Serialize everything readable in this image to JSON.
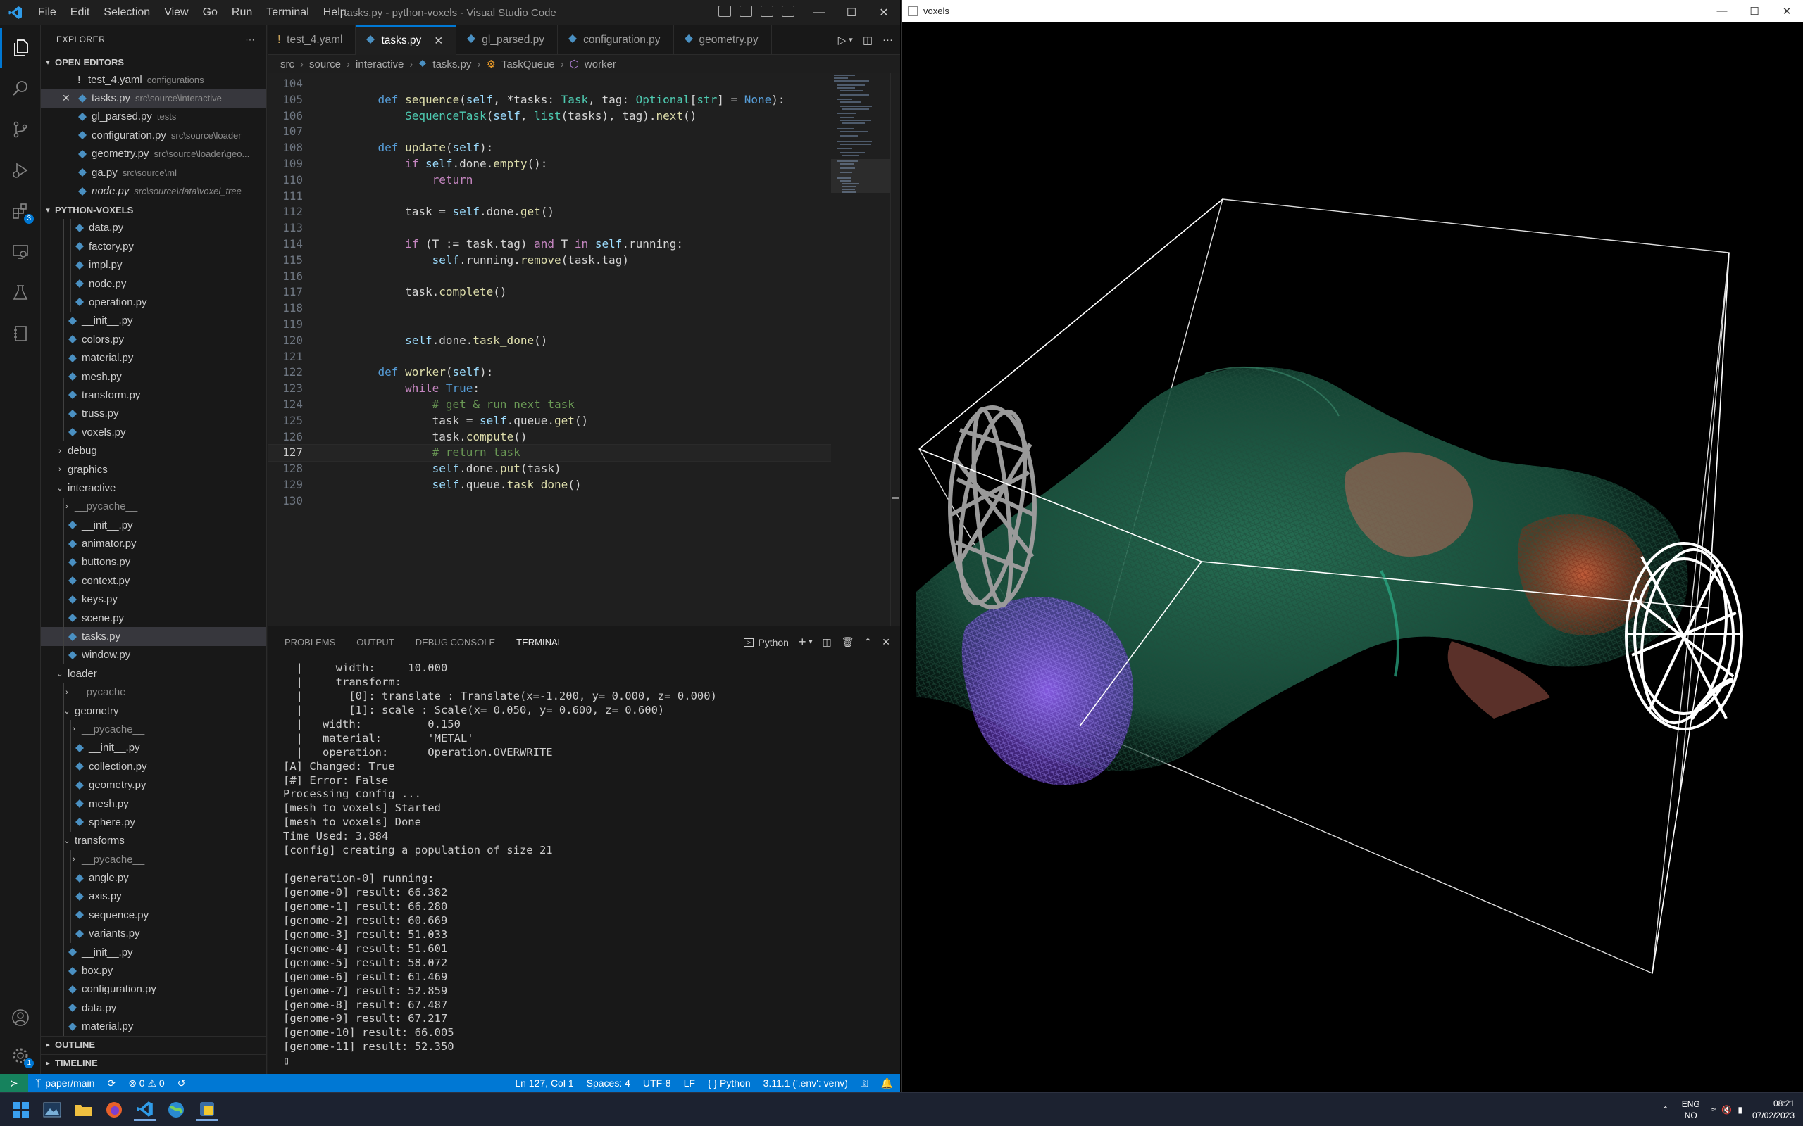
{
  "vscode": {
    "window_title": "tasks.py - python-voxels - Visual Studio Code",
    "menu": [
      "File",
      "Edit",
      "Selection",
      "View",
      "Go",
      "Run",
      "Terminal",
      "Help"
    ],
    "activity_badges": {
      "extensions": "3",
      "settings": "1"
    },
    "sidebar": {
      "title": "EXPLORER",
      "open_editors_label": "OPEN EDITORS",
      "open_editors": [
        {
          "name": "test_4.yaml",
          "desc": "configurations",
          "kind": "yaml"
        },
        {
          "name": "tasks.py",
          "desc": "src\\source\\interactive",
          "kind": "py"
        },
        {
          "name": "gl_parsed.py",
          "desc": "tests",
          "kind": "py"
        },
        {
          "name": "configuration.py",
          "desc": "src\\source\\loader",
          "kind": "py"
        },
        {
          "name": "geometry.py",
          "desc": "src\\source\\loader\\geo...",
          "kind": "py"
        },
        {
          "name": "ga.py",
          "desc": "src\\source\\ml",
          "kind": "py"
        },
        {
          "name": "node.py",
          "desc": "src\\source\\data\\voxel_tree",
          "kind": "py"
        }
      ],
      "project_label": "PYTHON-VOXELS",
      "tree": [
        "data.py",
        "factory.py",
        "impl.py",
        "node.py",
        "operation.py",
        "__init__.py",
        "colors.py",
        "material.py",
        "mesh.py",
        "transform.py",
        "truss.py",
        "voxels.py",
        "debug",
        "graphics",
        "interactive",
        "__pycache__",
        "__init__.py",
        "animator.py",
        "buttons.py",
        "context.py",
        "keys.py",
        "scene.py",
        "tasks.py",
        "window.py",
        "loader",
        "__pycache__",
        "geometry",
        "__pycache__",
        "__init__.py",
        "collection.py",
        "geometry.py",
        "mesh.py",
        "sphere.py",
        "transforms",
        "__pycache__",
        "angle.py",
        "axis.py",
        "sequence.py",
        "variants.py",
        "__init__.py",
        "box.py",
        "configuration.py",
        "data.py",
        "material.py"
      ],
      "outline_label": "OUTLINE",
      "timeline_label": "TIMELINE"
    },
    "tabs": [
      {
        "label": "test_4.yaml",
        "kind": "yaml"
      },
      {
        "label": "tasks.py",
        "kind": "py"
      },
      {
        "label": "gl_parsed.py",
        "kind": "py"
      },
      {
        "label": "configuration.py",
        "kind": "py"
      },
      {
        "label": "geometry.py",
        "kind": "py"
      }
    ],
    "breadcrumb": [
      "src",
      "source",
      "interactive",
      "tasks.py",
      "TaskQueue",
      "worker"
    ],
    "code": {
      "first_line": 104,
      "current_line": 127,
      "lines": [
        "",
        "    def sequence(self, *tasks: Task, tag: Optional[str] = None):",
        "        SequenceTask(self, list(tasks), tag).next()",
        "",
        "    def update(self):",
        "        if self.done.empty():",
        "            return",
        "",
        "        task = self.done.get()",
        "",
        "        if (T := task.tag) and T in self.running:",
        "            self.running.remove(task.tag)",
        "",
        "        task.complete()",
        "",
        "",
        "        self.done.task_done()",
        "",
        "    def worker(self):",
        "        while True:",
        "            # get & run next task",
        "            task = self.queue.get()",
        "            task.compute()",
        "            # return task",
        "            self.done.put(task)",
        "            self.queue.task_done()",
        ""
      ]
    },
    "panel": {
      "tabs": [
        "PROBLEMS",
        "OUTPUT",
        "DEBUG CONSOLE",
        "TERMINAL"
      ],
      "active_tab": "TERMINAL",
      "shell_label": "Python",
      "terminal_lines": [
        "  |     width:     10.000",
        "  |     transform:",
        "  |       [0]: translate : Translate(x=-1.200, y= 0.000, z= 0.000)",
        "  |       [1]: scale : Scale(x= 0.050, y= 0.600, z= 0.600)",
        "  |   width:          0.150",
        "  |   material:       'METAL'",
        "  |   operation:      Operation.OVERWRITE",
        "[A] Changed: True",
        "[#] Error: False",
        "Processing config ...",
        "[mesh_to_voxels] Started",
        "[mesh_to_voxels] Done",
        "Time Used: 3.884",
        "[config] creating a population of size 21",
        "",
        "[generation-0] running:",
        "[genome-0] result: 66.382",
        "[genome-1] result: 66.280",
        "[genome-2] result: 60.669",
        "[genome-3] result: 51.033",
        "[genome-4] result: 51.601",
        "[genome-5] result: 58.072",
        "[genome-6] result: 61.469",
        "[genome-7] result: 52.859",
        "[genome-8] result: 67.487",
        "[genome-9] result: 67.217",
        "[genome-10] result: 66.005",
        "[genome-11] result: 52.350",
        "▯"
      ]
    },
    "statusbar": {
      "branch": "paper/main",
      "problems": "⊗ 0 ⚠ 0",
      "cursor": "Ln 127, Col 1",
      "spaces": "Spaces: 4",
      "encoding": "UTF-8",
      "eol": "LF",
      "language": "{ } Python",
      "interpreter": "3.11.1 ('.env': venv)"
    }
  },
  "voxels_window": {
    "title": "voxels"
  },
  "taskbar": {
    "lang": "ENG",
    "region": "NO",
    "time": "08:21",
    "date": "07/02/2023"
  },
  "colors": {
    "accent": "#0078d4",
    "status_remote": "#16825d",
    "mesh_green": "#1e6b4f",
    "mesh_purple": "#7a4ae0",
    "mesh_orange": "#c8502a"
  }
}
